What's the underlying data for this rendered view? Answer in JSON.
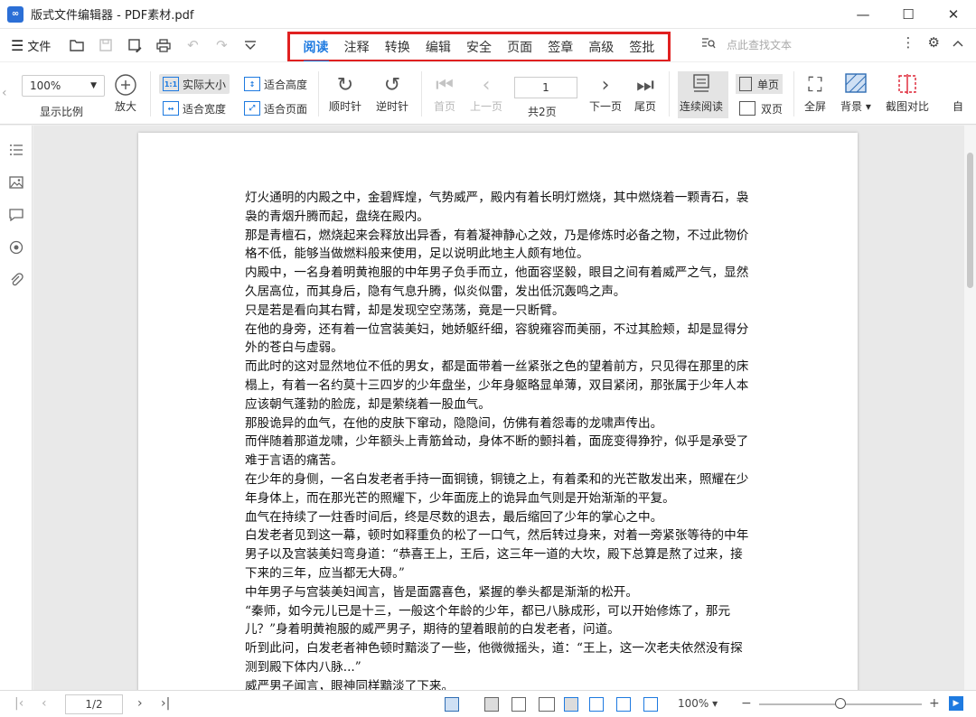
{
  "window": {
    "title": "版式文件编辑器 - PDF素材.pdf",
    "minimize": "—",
    "maximize": "☐",
    "close": "✕"
  },
  "menu": {
    "file_label": "文件",
    "tabs": [
      {
        "label": "阅读",
        "active": true
      },
      {
        "label": "注释"
      },
      {
        "label": "转换"
      },
      {
        "label": "编辑"
      },
      {
        "label": "安全"
      },
      {
        "label": "页面"
      },
      {
        "label": "签章"
      },
      {
        "label": "高级"
      },
      {
        "label": "签批"
      }
    ],
    "search_placeholder": "点此查找文本"
  },
  "toolbar": {
    "zoom_value": "100%",
    "zoom_label": "显示比例",
    "zoom_in": "放大",
    "actual_size": "实际大小",
    "fit_width": "适合宽度",
    "fit_height": "适合高度",
    "fit_page": "适合页面",
    "rotate_cw": "顺时针",
    "rotate_ccw": "逆时针",
    "first_page": "首页",
    "prev_page": "上一页",
    "page_input": "1",
    "page_total": "共2页",
    "next_page": "下一页",
    "last_page": "尾页",
    "continuous": "连续阅读",
    "single_page": "单页",
    "double_page": "双页",
    "fullscreen": "全屏",
    "background": "背景",
    "screenshot_compare": "截图对比",
    "overflow": "自"
  },
  "document": {
    "paragraphs": [
      "灯火通明的内殿之中，金碧辉煌，气势威严，殿内有着长明灯燃烧，其中燃烧着一颗青石，袅袅的青烟升腾而起，盘绕在殿内。",
      "那是青檀石，燃烧起来会释放出异香，有着凝神静心之效，乃是修炼时必备之物，不过此物价格不低，能够当做燃料般来使用，足以说明此地主人颇有地位。",
      "内殿中，一名身着明黄袍服的中年男子负手而立，他面容坚毅，眼目之间有着威严之气，显然久居高位，而其身后，隐有气息升腾，似炎似雷，发出低沉轰鸣之声。",
      "只是若是看向其右臂，却是发现空空荡荡，竟是一只断臂。",
      "在他的身旁，还有着一位宫装美妇，她娇躯纤细，容貌雍容而美丽，不过其脸颊，却是显得分外的苍白与虚弱。",
      "而此时的这对显然地位不低的男女，都是面带着一丝紧张之色的望着前方，只见得在那里的床榻上，有着一名约莫十三四岁的少年盘坐，少年身躯略显单薄，双目紧闭，那张属于少年人本应该朝气蓬勃的脸庞，却是萦绕着一股血气。",
      "那股诡异的血气，在他的皮肤下窜动，隐隐间，仿佛有着怨毒的龙啸声传出。",
      "而伴随着那道龙啸，少年额头上青筋耸动，身体不断的颤抖着，面庞变得狰狞，似乎是承受了难于言语的痛苦。",
      "在少年的身侧，一名白发老者手持一面铜镜，铜镜之上，有着柔和的光芒散发出来，照耀在少年身体上，而在那光芒的照耀下，少年面庞上的诡异血气则是开始渐渐的平复。",
      "血气在持续了一炷香时间后，终是尽数的退去，最后缩回了少年的掌心之中。",
      "白发老者见到这一幕，顿时如释重负的松了一口气，然后转过身来，对着一旁紧张等待的中年男子以及宫装美妇弯身道：“恭喜王上，王后，这三年一道的大坎，殿下总算是熬了过来，接下来的三年，应当都无大碍。”",
      "中年男子与宫装美妇闻言，皆是面露喜色，紧握的拳头都是渐渐的松开。",
      "“秦师，如今元儿已是十三，一般这个年龄的少年，都已八脉成形，可以开始修炼了，那元儿？”身着明黄袍服的威严男子，期待的望着眼前的白发老者，问道。",
      "听到此问，白发老者神色顿时黯淡了一些，他微微摇头，道：“王上，这一次老夫依然没有探测到殿下体内八脉...”",
      "威严男子闻言，眼神同样黯淡了下来。"
    ]
  },
  "statusbar": {
    "page_display": "1/2",
    "zoom_value": "100%",
    "zoom_fraction": 0.5,
    "minus": "−",
    "plus": "+"
  },
  "colors": {
    "accent": "#1e7ae0",
    "highlight_border": "#e02020"
  }
}
